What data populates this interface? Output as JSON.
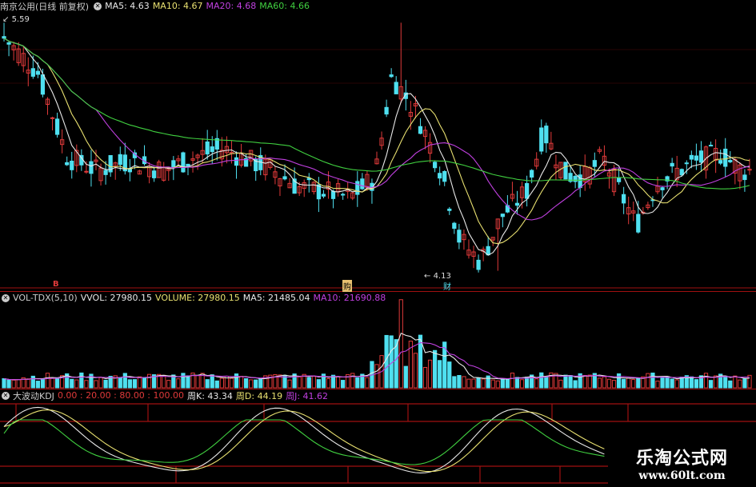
{
  "colors": {
    "up": "#e03a3a",
    "down": "#4fe0f0",
    "ma5": "#e8e8e8",
    "ma10": "#e8e070",
    "ma20": "#c040e0",
    "ma60": "#40d040",
    "kdj_k": "#e8e8e8",
    "kdj_d": "#e8e070",
    "kdj_j": "#c040e0",
    "grid": "#a01010"
  },
  "price_header": {
    "stock": "南京公用(日线 前复权)",
    "toggle_icon": "circle-toggle-icon",
    "ma5": "MA5: 4.63",
    "ma10": "MA10: 4.67",
    "ma20": "MA20: 4.68",
    "ma60": "MA60: 4.66"
  },
  "price_annotations": {
    "high_label": "5.59",
    "low_label": "4.13",
    "signal_1": "B",
    "signal_2": "购",
    "signal_3": "财"
  },
  "volume_header": {
    "name": "VOL-TDX(5,10)",
    "vvol": "VVOL: 27980.15",
    "volume": "VOLUME: 27980.15",
    "ma5": "MA5: 21485.04",
    "ma10": "MA10: 21690.88"
  },
  "kdj_header": {
    "name": "大波动KDJ",
    "levels": "0.00 : 20.00 : 80.00 : 100.00",
    "k": "周K: 43.34",
    "d": "周D: 44.19",
    "j": "周J: 41.62"
  },
  "watermark": {
    "title": "乐淘公式网",
    "url": "www.60lt.com"
  },
  "chart_data": {
    "type": "candlestick",
    "price_range": [
      4.13,
      5.59
    ],
    "ma_periods": [
      5,
      10,
      20,
      60
    ],
    "kdj_levels": [
      0,
      20,
      80,
      100
    ],
    "last_values": {
      "ma5": 4.63,
      "ma10": 4.67,
      "ma20": 4.68,
      "ma60": 4.66,
      "vvol": 27980.15,
      "volume": 27980.15,
      "vol_ma5": 21485.04,
      "vol_ma10": 21690.88,
      "k": 43.34,
      "d": 44.19,
      "j": 41.62
    }
  }
}
